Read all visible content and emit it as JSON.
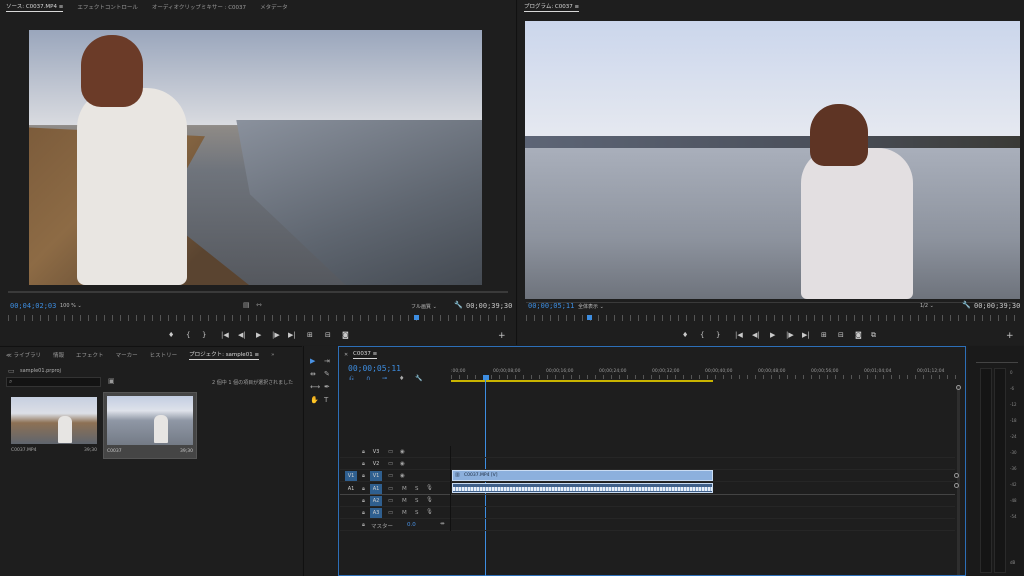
{
  "source_panel": {
    "tabs": [
      "ソース: C0037.MP4 ≡",
      "エフェクトコントロール",
      "オーディオクリップミキサー : C0037",
      "メタデータ"
    ],
    "timecode_current": "00;04;02;03",
    "zoom": "100 %",
    "resolution": "フル画質",
    "timecode_duration": "00;00;39;30"
  },
  "program_panel": {
    "tab": "プログラム: C0037 ≡",
    "timecode_current": "00;00;05;11",
    "fit": "全体表示",
    "resolution": "1/2",
    "timecode_duration": "00;00;39;30"
  },
  "project_panel": {
    "tabs": [
      "ライブラリ",
      "情報",
      "エフェクト",
      "マーカー",
      "ヒストリー",
      "プロジェクト: sample01 ≡"
    ],
    "project_file": "sample01.prproj",
    "selection_status": "2 個中 1 個の項目が選択されました",
    "items": [
      {
        "name": "C0037.MP4",
        "duration": "39;30"
      },
      {
        "name": "C0037",
        "duration": "39;30"
      }
    ]
  },
  "timeline": {
    "sequence_tab": "C0037 ≡",
    "timecode": "00;00;05;11",
    "ruler_labels": [
      ":00;00",
      "00;00;08;00",
      "00;00;16;00",
      "00;00;24;00",
      "00;00;32;00",
      "00;00;40;00",
      "00;00;48;00",
      "00;00;56;00",
      "00;01;04;04",
      "00;01;12;04"
    ],
    "video_tracks": [
      "V3",
      "V2",
      "V1"
    ],
    "audio_tracks": [
      "A1",
      "A2",
      "A3"
    ],
    "source_patch_v": "V1",
    "source_patch_a": "A1",
    "master_label": "マスター",
    "master_value": "0.0",
    "clip_label": "C0037.MP4 [V]",
    "mute_label": "M",
    "solo_label": "S"
  },
  "tools": [
    "▶",
    "⇥",
    "⇹",
    "✎",
    "⟷",
    "✒",
    "✋",
    "T"
  ],
  "vu_meter_labels": [
    "0",
    "-6",
    "-12",
    "-18",
    "-24",
    "-30",
    "-36",
    "-42",
    "-48",
    "-54",
    "dB"
  ]
}
